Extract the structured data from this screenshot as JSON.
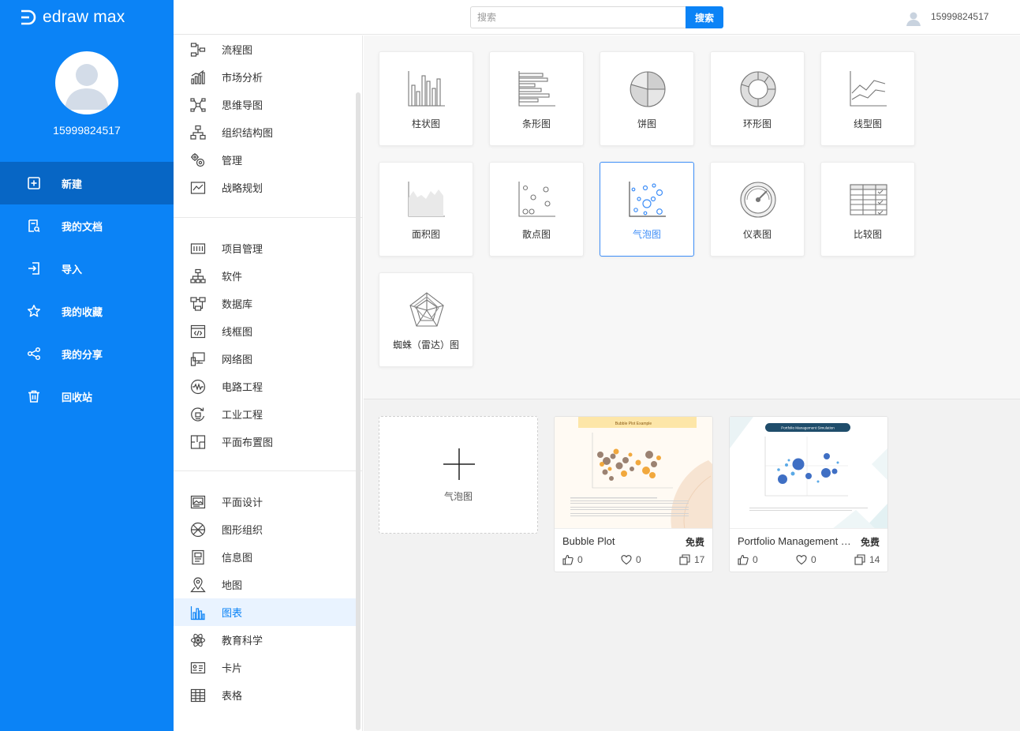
{
  "app": {
    "logo_text": "edraw max",
    "brand_color": "#0b83f6"
  },
  "user": {
    "name": "15999824517"
  },
  "nav": [
    {
      "label": "新建",
      "icon": "new-file-icon"
    },
    {
      "label": "我的文档",
      "icon": "documents-icon"
    },
    {
      "label": "导入",
      "icon": "import-icon"
    },
    {
      "label": "我的收藏",
      "icon": "star-icon"
    },
    {
      "label": "我的分享",
      "icon": "share-icon"
    },
    {
      "label": "回收站",
      "icon": "trash-icon"
    }
  ],
  "search": {
    "placeholder": "搜索",
    "button": "搜索"
  },
  "categories": {
    "group1": [
      {
        "label": "流程图",
        "icon": "flowchart-icon"
      },
      {
        "label": "市场分析",
        "icon": "market-analysis-icon"
      },
      {
        "label": "思维导图",
        "icon": "mindmap-icon"
      },
      {
        "label": "组织结构图",
        "icon": "org-chart-icon"
      },
      {
        "label": "管理",
        "icon": "management-icon"
      },
      {
        "label": "战略规划",
        "icon": "strategy-icon"
      }
    ],
    "group2": [
      {
        "label": "项目管理",
        "icon": "project-icon"
      },
      {
        "label": "软件",
        "icon": "software-icon"
      },
      {
        "label": "数据库",
        "icon": "database-icon"
      },
      {
        "label": "线框图",
        "icon": "wireframe-icon"
      },
      {
        "label": "网络图",
        "icon": "network-icon"
      },
      {
        "label": "电路工程",
        "icon": "circuit-icon"
      },
      {
        "label": "工业工程",
        "icon": "industrial-icon"
      },
      {
        "label": "平面布置图",
        "icon": "floorplan-icon"
      }
    ],
    "group3": [
      {
        "label": "平面设计",
        "icon": "graphic-design-icon"
      },
      {
        "label": "图形组织",
        "icon": "graphic-organizer-icon"
      },
      {
        "label": "信息图",
        "icon": "infographic-icon"
      },
      {
        "label": "地图",
        "icon": "map-pin-icon"
      },
      {
        "label": "图表",
        "icon": "chart-icon"
      },
      {
        "label": "教育科学",
        "icon": "science-icon"
      },
      {
        "label": "卡片",
        "icon": "card-icon"
      },
      {
        "label": "表格",
        "icon": "table-icon"
      }
    ]
  },
  "chart_types": [
    {
      "label": "柱状图",
      "icon": "column-chart-icon"
    },
    {
      "label": "条形图",
      "icon": "bar-chart-icon"
    },
    {
      "label": "饼图",
      "icon": "pie-chart-icon"
    },
    {
      "label": "环形图",
      "icon": "donut-chart-icon"
    },
    {
      "label": "线型图",
      "icon": "line-chart-icon"
    },
    {
      "label": "面积图",
      "icon": "area-chart-icon"
    },
    {
      "label": "散点图",
      "icon": "scatter-chart-icon"
    },
    {
      "label": "气泡图",
      "icon": "bubble-chart-icon"
    },
    {
      "label": "仪表图",
      "icon": "gauge-chart-icon"
    },
    {
      "label": "比较图",
      "icon": "comparison-chart-icon"
    },
    {
      "label": "蜘蛛（雷达）图",
      "icon": "radar-chart-icon"
    }
  ],
  "new_blank": {
    "label": "气泡图"
  },
  "templates": [
    {
      "title": "Bubble Plot",
      "price": "免费",
      "likes": "0",
      "favorites": "0",
      "copies": "17",
      "thumb_title": "Bubble Plot Example"
    },
    {
      "title": "Portfolio Management Simulation",
      "price": "免费",
      "likes": "0",
      "favorites": "0",
      "copies": "14",
      "thumb_title": "Portfolio Management Simulation"
    }
  ]
}
